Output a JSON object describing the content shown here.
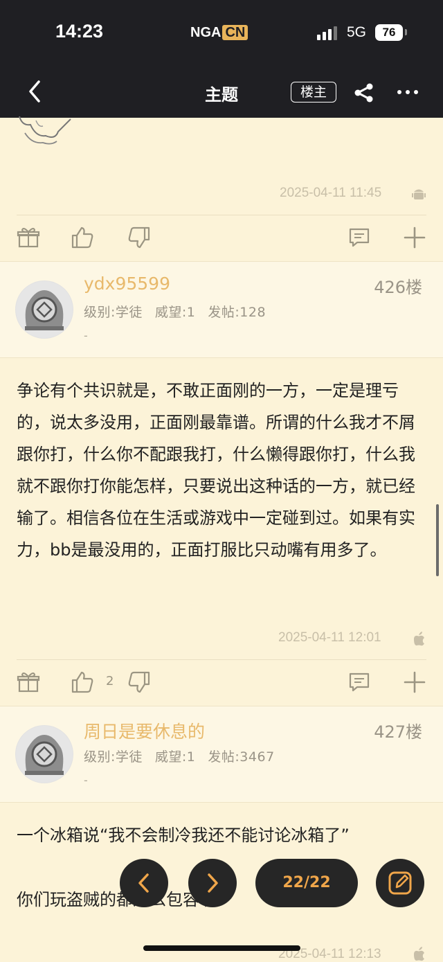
{
  "status_bar": {
    "time": "14:23",
    "logo_main": "NGA",
    "logo_suffix": "CN",
    "network": "5G",
    "battery": "76"
  },
  "nav": {
    "title": "主题",
    "owner_button": "楼主"
  },
  "posts": [
    {
      "timestamp": "2025-04-11 11:45",
      "device": "android-icon"
    },
    {
      "username": "ydx95599",
      "floor": "426楼",
      "level": "级别:学徒",
      "prestige": "威望:1",
      "post_count": "发帖:128",
      "signature": "-",
      "content": "争论有个共识就是，不敢正面刚的一方，一定是理亏的，说太多没用，正面刚最靠谱。所谓的什么我才不屑跟你打，什么你不配跟我打，什么懒得跟你打，什么我就不跟你打你能怎样，只要说出这种话的一方，就已经输了。相信各位在生活或游戏中一定碰到过。如果有实力，bb是最没用的，正面打服比只动嘴有用多了。",
      "timestamp": "2025-04-11 12:01",
      "device": "apple-icon",
      "like_count": "2"
    },
    {
      "username": "周日是要休息的",
      "floor": "427楼",
      "level": "级别:学徒",
      "prestige": "威望:1",
      "post_count": "发帖:3467",
      "signature": "-",
      "content_line1": "一个冰箱说“我不会制冷我还不能讨论冰箱了”",
      "content_line2": "你们玩盗贼的都这么包容啊?",
      "timestamp": "2025-04-11 12:13",
      "device": "apple-icon"
    }
  ],
  "pager": {
    "label": "22/22"
  },
  "colors": {
    "bar": "#1f1f23",
    "page": "#fcf3d8",
    "accent": "#e8b96b",
    "fab": "#262626",
    "pager_text": "#f0a64a"
  }
}
